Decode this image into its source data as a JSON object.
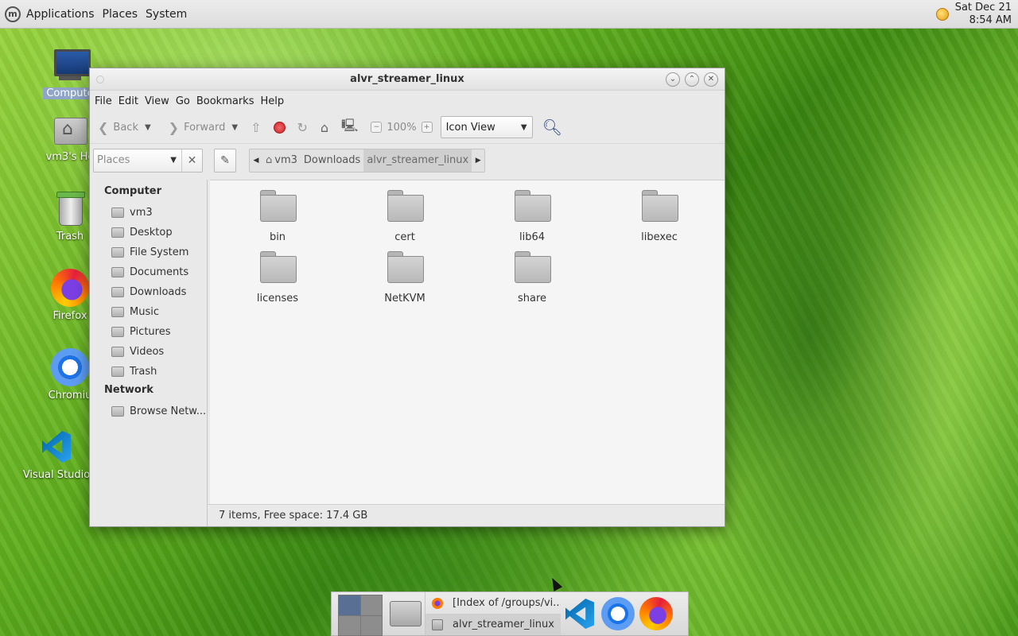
{
  "top_panel": {
    "menus": [
      "Applications",
      "Places",
      "System"
    ],
    "clock_date": "Sat Dec 21",
    "clock_time": "8:54 AM"
  },
  "desktop": {
    "icons": [
      {
        "label": "Compute",
        "icon": "computer-icon"
      },
      {
        "label": "vm3's Ho",
        "icon": "home-folder-icon"
      },
      {
        "label": "Trash",
        "icon": "trash-icon"
      },
      {
        "label": "Firefox",
        "icon": "firefox-icon"
      },
      {
        "label": "Chromiu",
        "icon": "chromium-icon"
      },
      {
        "label": "Visual Studio",
        "icon": "vscode-icon"
      }
    ]
  },
  "window": {
    "title": "alvr_streamer_linux",
    "menu": [
      "File",
      "Edit",
      "View",
      "Go",
      "Bookmarks",
      "Help"
    ],
    "toolbar": {
      "back": "Back",
      "forward": "Forward",
      "zoom": "100%",
      "view_mode": "Icon View"
    },
    "location": {
      "places_placeholder": "Places",
      "crumbs": [
        "vm3",
        "Downloads",
        "alvr_streamer_linux"
      ]
    },
    "sidebar": {
      "computer_heading": "Computer",
      "computer_items": [
        "vm3",
        "Desktop",
        "File System",
        "Documents",
        "Downloads",
        "Music",
        "Pictures",
        "Videos",
        "Trash"
      ],
      "network_heading": "Network",
      "network_items": [
        "Browse Netw..."
      ]
    },
    "files": [
      "bin",
      "cert",
      "lib64",
      "libexec",
      "licenses",
      "NetKVM",
      "share"
    ],
    "status": "7 items, Free space: 17.4 GB"
  },
  "taskbar": {
    "tasks": [
      "[Index of /groups/vi...",
      "alvr_streamer_linux"
    ],
    "launchers": [
      "vscode-icon",
      "chromium-icon",
      "firefox-icon"
    ]
  }
}
